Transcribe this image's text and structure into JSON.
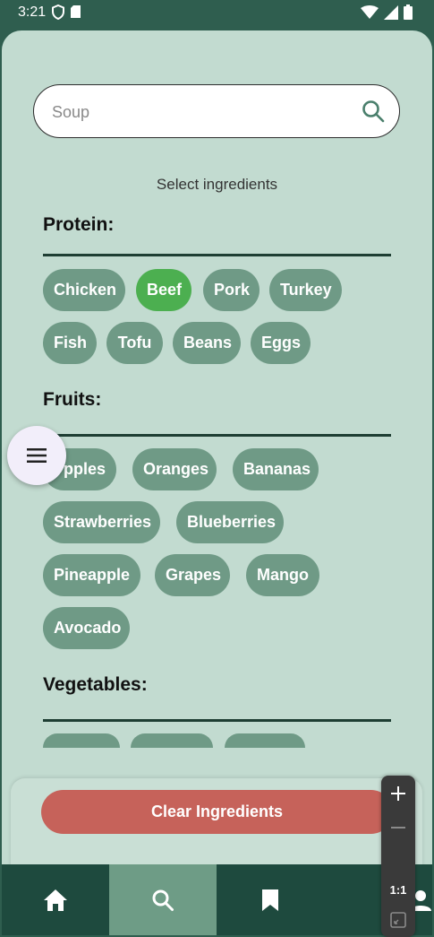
{
  "status_bar": {
    "time": "3:21"
  },
  "search": {
    "placeholder": "Soup"
  },
  "subtitle": "Select ingredients",
  "sections": {
    "protein": {
      "title": "Protein:",
      "items": [
        "Chicken",
        "Beef",
        "Pork",
        "Turkey",
        "Fish",
        "Tofu",
        "Beans",
        "Eggs"
      ],
      "selected": [
        "Beef"
      ]
    },
    "fruits": {
      "title": "Fruits:",
      "items": [
        "pples",
        "Oranges",
        "Bananas",
        "Strawberries",
        "Blueberries",
        "Pineapple",
        "Grapes",
        "Mango",
        "Avocado"
      ]
    },
    "vegetables": {
      "title": "Vegetables:"
    }
  },
  "clear_button": "Clear Ingredients",
  "bottom_nav": [
    "home-icon",
    "search-icon",
    "bookmark-icon",
    "profile-icon"
  ],
  "active_tab": "search",
  "zoom_controls": {
    "ratio": "1:1"
  },
  "colors": {
    "background": "#c2dbd0",
    "chip": "#6f9a86",
    "chip_selected": "#4caf50",
    "clear_button": "#c6625a",
    "nav": "#1e4a3e",
    "nav_active": "#6e9c86"
  }
}
